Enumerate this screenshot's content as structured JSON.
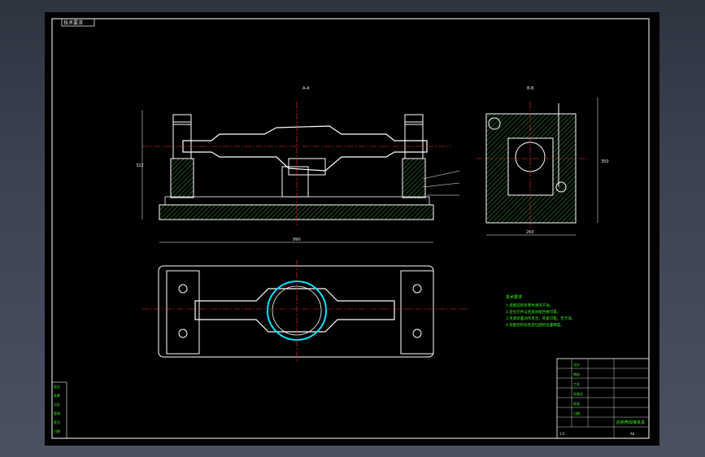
{
  "drawing": {
    "corner_tag": "技术要求",
    "view_label_top": "A-A",
    "view_label_side": "B-B",
    "dim_front_width": "990",
    "dim_side_width": "260",
    "dim_side_height": "350",
    "dim_front_height": "322",
    "tech_title": "技术要求",
    "tech_notes": [
      "1.装配前所有零件清洗干净。",
      "2.定位元件与夹具体配合要可靠。",
      "3.夹紧装置动作灵活，夹紧可靠，无卡滞。",
      "4.装配后检验各定位面的位置精度。"
    ],
    "side_strip": [
      "标记",
      "处数",
      "分区",
      "更改",
      "签名",
      "日期"
    ],
    "title_block": {
      "name": "后桥壳焊接夹具",
      "scale": "1:5",
      "sheet": "A0",
      "rows": [
        "设计",
        "审核",
        "工艺",
        "标准化",
        "批准",
        "日期"
      ]
    }
  },
  "colors": {
    "line": "#ffffff",
    "hatch": "#39ff14",
    "accent": "#00e5ff",
    "red": "#ff3030",
    "yellow": "#ffff40"
  }
}
